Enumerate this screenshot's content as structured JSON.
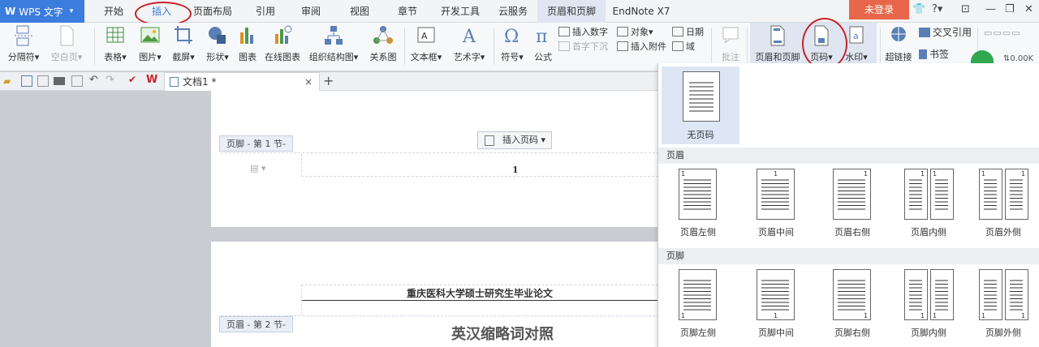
{
  "app": {
    "name": "WPS 文字"
  },
  "menu": {
    "tabs": [
      "开始",
      "插入",
      "页面布局",
      "引用",
      "审阅",
      "视图",
      "章节",
      "开发工具",
      "云服务",
      "页眉和页脚",
      "EndNote X7"
    ],
    "login": "未登录",
    "help": "?"
  },
  "ribbon": {
    "page_break": "分隔符",
    "blank_page": "空白页",
    "table": "表格",
    "picture": "图片",
    "screenshot": "截屏",
    "shape": "形状",
    "chart": "图表",
    "online_chart": "在线图表",
    "org_chart": "组织结构图",
    "relation_chart": "关系图",
    "textbox": "文本框",
    "wordart": "艺术字",
    "symbol": "符号",
    "formula": "公式",
    "insert_number": "插入数字",
    "object": "对象",
    "date": "日期",
    "drop_cap": "首字下沉",
    "insert_attachment": "插入附件",
    "field": "域",
    "comment": "批注",
    "header_footer": "页眉和页脚",
    "page_number": "页码",
    "watermark": "水印",
    "hyperlink": "超链接",
    "cross_ref": "交叉引用",
    "bookmark": "书签",
    "net_speed": "0.00K"
  },
  "tabs_bar": {
    "doc_name": "文档1 *",
    "close": "×",
    "add": "+"
  },
  "document": {
    "footer_tag": "页脚 - 第 1 节-",
    "insert_page_number": "插入页码",
    "page_number_text": "1",
    "header_tag": "页眉 - 第 2 节-",
    "header_text": "重庆医科大学硕士研究生毕业论文",
    "heading": "英汉缩略词对照"
  },
  "dropdown": {
    "none_label": "无页码",
    "header_section": "页眉",
    "header_options": [
      "页眉左侧",
      "页眉中间",
      "页眉右侧",
      "页眉内侧",
      "页眉外侧"
    ],
    "footer_section": "页脚",
    "footer_options": [
      "页脚左侧",
      "页脚中间",
      "页脚右侧",
      "页脚内侧",
      "页脚外侧"
    ],
    "page_mark": "1"
  },
  "colors": {
    "accent": "#3b7ddd",
    "highlight": "#c8232c",
    "login": "#e8674a"
  }
}
